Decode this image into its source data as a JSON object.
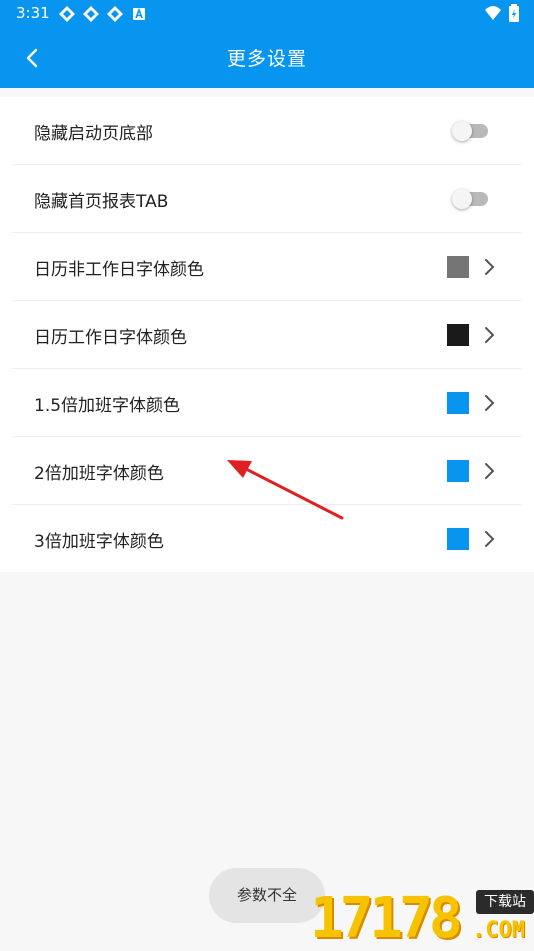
{
  "status_bar": {
    "time": "3:31",
    "left_icons": [
      "app-icon",
      "app-icon",
      "app-icon",
      "a-badge-icon"
    ],
    "right_icons": [
      "wifi-icon",
      "battery-icon"
    ]
  },
  "app_bar": {
    "title": "更多设置",
    "back_icon": "chevron-left-icon",
    "background": "#0895f0"
  },
  "settings": {
    "rows": [
      {
        "label": "隐藏启动页底部",
        "type": "toggle",
        "on": false
      },
      {
        "label": "隐藏首页报表TAB",
        "type": "toggle",
        "on": false
      },
      {
        "label": "日历非工作日字体颜色",
        "type": "color",
        "color": "#757575"
      },
      {
        "label": "日历工作日字体颜色",
        "type": "color",
        "color": "#1a1a1a"
      },
      {
        "label": "1.5倍加班字体颜色",
        "type": "color",
        "color": "#0895f0"
      },
      {
        "label": "2倍加班字体颜色",
        "type": "color",
        "color": "#0895f0"
      },
      {
        "label": "3倍加班字体颜色",
        "type": "color",
        "color": "#0895f0"
      }
    ]
  },
  "toast": {
    "text": "参数不全"
  },
  "watermark": {
    "digits": "17178",
    "badge": "下载站",
    "suffix": ".COM"
  },
  "annotation": {
    "color": "#e02020"
  }
}
